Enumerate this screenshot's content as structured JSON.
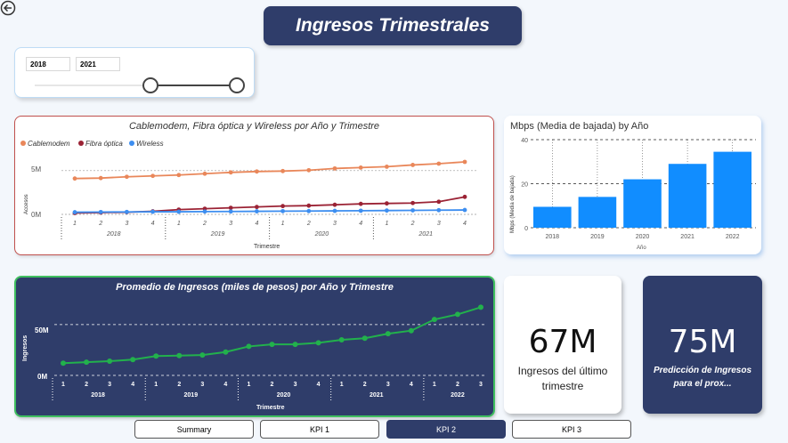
{
  "title": "Ingresos Trimestrales",
  "slicer": {
    "from": "2018",
    "to": "2021"
  },
  "line_chart": {
    "title": "Cablemodem, Fibra óptica y Wireless por Año y Trimestre",
    "legend": [
      "Cablemodem",
      "Fibra óptica",
      "Wireless"
    ],
    "ylabel": "Accesos",
    "xlabel": "Trimestre",
    "yticks": [
      "5M",
      "0M"
    ]
  },
  "bar_chart": {
    "title": "Mbps (Media de bajada) by Año",
    "ylabel": "Mbps (Media de bajada)",
    "xlabel": "Año",
    "yticks": [
      "40",
      "20",
      "0"
    ]
  },
  "avg_chart": {
    "title": "Promedio de Ingresos (miles de pesos) por Año y Trimestre",
    "ylabel": "Ingresos",
    "xlabel": "Trimestre",
    "yticks": [
      "50M",
      "0M"
    ]
  },
  "kpi": {
    "value": "67M",
    "label": "Ingresos del último trimestre"
  },
  "prediction": {
    "value": "75M",
    "label": "Predicción de Ingresos para el prox..."
  },
  "nav": [
    "Summary",
    "KPI 1",
    "KPI 2",
    "KPI 3"
  ],
  "colors": {
    "cablemodem": "#e9875a",
    "fibra": "#9b2335",
    "wireless": "#3d8ef0",
    "bar": "#118dff",
    "avg": "#22b14c",
    "navy": "#2f3d6a"
  },
  "chart_data": [
    {
      "type": "line",
      "title": "Cablemodem, Fibra óptica y Wireless por Año y Trimestre",
      "x": [
        "2018-1",
        "2018-2",
        "2018-3",
        "2018-4",
        "2019-1",
        "2019-2",
        "2019-3",
        "2019-4",
        "2020-1",
        "2020-2",
        "2020-3",
        "2020-4",
        "2021-1",
        "2021-2",
        "2021-3",
        "2021-4"
      ],
      "years": [
        "2018",
        "2019",
        "2020",
        "2021"
      ],
      "quarters": [
        "1",
        "2",
        "3",
        "4"
      ],
      "ylim": [
        0,
        6
      ],
      "series": [
        {
          "name": "Cablemodem",
          "values": [
            4.1,
            4.15,
            4.3,
            4.4,
            4.5,
            4.65,
            4.8,
            4.9,
            4.95,
            5.05,
            5.25,
            5.35,
            5.45,
            5.65,
            5.8,
            6.0
          ]
        },
        {
          "name": "Fibra óptica",
          "values": [
            0.15,
            0.2,
            0.25,
            0.35,
            0.55,
            0.65,
            0.75,
            0.85,
            0.95,
            1.0,
            1.1,
            1.2,
            1.25,
            1.3,
            1.45,
            2.0
          ]
        },
        {
          "name": "Wireless",
          "values": [
            0.25,
            0.27,
            0.28,
            0.3,
            0.3,
            0.32,
            0.33,
            0.35,
            0.37,
            0.38,
            0.4,
            0.42,
            0.44,
            0.46,
            0.48,
            0.5
          ]
        }
      ]
    },
    {
      "type": "bar",
      "title": "Mbps (Media de bajada) by Año",
      "categories": [
        "2018",
        "2019",
        "2020",
        "2021",
        "2022"
      ],
      "values": [
        9.5,
        14,
        22,
        29,
        34.5
      ],
      "ylim": [
        0,
        40
      ],
      "yticks": [
        0,
        20,
        40
      ]
    },
    {
      "type": "line",
      "title": "Promedio de Ingresos (miles de pesos) por Año y Trimestre",
      "x": [
        "2018-1",
        "2018-2",
        "2018-3",
        "2018-4",
        "2019-1",
        "2019-2",
        "2019-3",
        "2019-4",
        "2020-1",
        "2020-2",
        "2020-3",
        "2020-4",
        "2021-1",
        "2021-2",
        "2021-3",
        "2021-4",
        "2022-1",
        "2022-2",
        "2022-3"
      ],
      "years": [
        "2018",
        "2019",
        "2020",
        "2021",
        "2022"
      ],
      "quarters": [
        "1",
        "2",
        "3",
        "4",
        "1",
        "2",
        "3",
        "4",
        "1",
        "2",
        "3",
        "4",
        "1",
        "2",
        "3",
        "4",
        "1",
        "2",
        "3"
      ],
      "ylim": [
        0,
        70
      ],
      "yticks": [
        0,
        50
      ],
      "series": [
        {
          "name": "Ingresos",
          "values": [
            12,
            13,
            14,
            15.5,
            19,
            19.5,
            20,
            23,
            28.5,
            30.5,
            30.5,
            32,
            35,
            36.5,
            41,
            44,
            55,
            60,
            67
          ]
        }
      ]
    }
  ]
}
